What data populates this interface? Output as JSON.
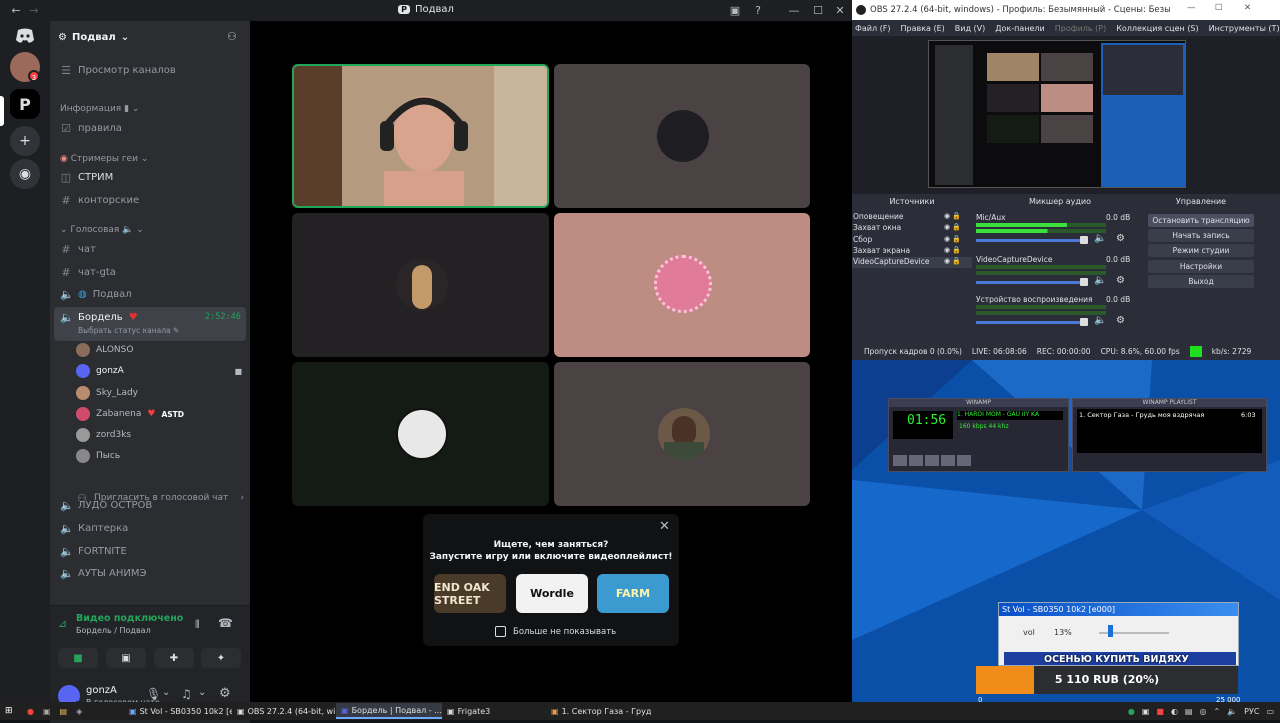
{
  "discord": {
    "title": "Подвал",
    "server_name": "Подвал",
    "browse_channels": "Просмотр каналов",
    "info_category": "Информация",
    "rules": "правила",
    "streamers_category": "Стримеры геи",
    "stream": "СТРИМ",
    "office": "конторские",
    "voice_category": "Голосовая",
    "chat": "чат",
    "chat_gta": "чат-gta",
    "voice_podval": "Подвал",
    "voice_bordel": "Бордель",
    "bordel_time": "2:52:46",
    "bordel_status": "Выбрать статус канала",
    "users": [
      {
        "name": "ALONSO",
        "color": "#8a6d5a"
      },
      {
        "name": "gonzA",
        "color": "#5865f2"
      },
      {
        "name": "Sky_Lady",
        "color": "#b98c70"
      },
      {
        "name": "Zabanena",
        "color": "#d04c6a",
        "tag": "ASTD"
      },
      {
        "name": "zord3ks",
        "color": "#999"
      },
      {
        "name": "Пысь",
        "color": "#888"
      }
    ],
    "invite": "Пригласить в голосовой чат",
    "more_channels": [
      "ЛУДО ОСТРОВ",
      "Каптерка",
      "FORTNITE",
      "АУТЫ АНИМЭ"
    ],
    "voice_connected": "Видео подключено",
    "voice_location": "Бордель / Подвал",
    "username": "gonzA",
    "user_status": "В голосовом чате",
    "popup_title": "Ищете, чем заняться?",
    "popup_sub": "Запустите игру или включите видеоплейлист!",
    "games": [
      "END OAK STREET",
      "Wordle",
      "FARM"
    ],
    "dont_show": "Больше не показывать",
    "notif_count": "3"
  },
  "obs": {
    "title": "OBS 27.2.4 (64-bit, windows) - Профиль: Безымянный - Сцены: Безымянный",
    "menu": [
      "Файл (F)",
      "Правка (E)",
      "Вид (V)",
      "Док-панели",
      "Профиль (P)",
      "Коллекция сцен (S)",
      "Инструменты (T)"
    ],
    "docks": {
      "sources": "Источники",
      "mixer": "Микшер аудио",
      "controls": "Управление"
    },
    "sources": [
      "Оповещение",
      "Захват окна",
      "Сбор",
      "Захват экрана",
      "VideoCaptureDevice"
    ],
    "mixer": [
      {
        "name": "Mic/Aux",
        "db": "0.0 dB"
      },
      {
        "name": "VideoCaptureDevice",
        "db": "0.0 dB"
      },
      {
        "name": "Устройство воспроизведения",
        "db": "0.0 dB"
      }
    ],
    "controls": [
      "Остановить трансляцию",
      "Начать запись",
      "Режим студии",
      "Настройки",
      "Выход"
    ],
    "status": {
      "dropped": "Пропуск кадров 0 (0.0%)",
      "live": "LIVE: 06:08:06",
      "rec": "REC: 00:00:00",
      "cpu": "CPU: 8.6%, 60.00 fps",
      "kbs": "kb/s: 2729"
    }
  },
  "winamp": {
    "title": "WINAMP",
    "playlist_title": "WINAMP PLAYLIST",
    "time": "01:56",
    "track": "1. HAROI MOM - GAU IIY KA",
    "kbps": "160",
    "khz": "44",
    "playlist_item": "1. Сектор Газа - Грудь моя вздрячая",
    "playlist_time": "6:03"
  },
  "stvol": {
    "title": "St Vol - SB0350 10k2 [e000]",
    "label": "vol",
    "value": "13%",
    "level": 0.13
  },
  "donate": {
    "banner": "ОСЕНЬЮ КУПИТЬ ВИДЯХУ",
    "amount": "5 110 RUB (20%)",
    "start": "0",
    "goal": "25 000",
    "progress": 0.2
  },
  "taskbar": {
    "tasks": [
      "St Vol - SB0350 10k2 [e...",
      "OBS 27.2.4 (64-bit, wi...",
      "Бордель | Подвал - ...",
      "Frigate3",
      "1. Сектор Газа - Груд..."
    ],
    "lang": "РУС"
  }
}
